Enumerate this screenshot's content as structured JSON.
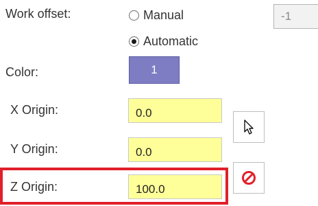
{
  "work_offset": {
    "label": "Work offset:",
    "manual_label": "Manual",
    "automatic_label": "Automatic",
    "selected": "Automatic",
    "offset_value": "-1"
  },
  "color": {
    "label": "Color:",
    "value": "1",
    "swatch_color": "#7e7dc4"
  },
  "x_origin": {
    "label": "X Origin:",
    "value": "0.0"
  },
  "y_origin": {
    "label": "Y Origin:",
    "value": "0.0"
  },
  "z_origin": {
    "label": "Z Origin:",
    "value": "100.0"
  },
  "buttons": {
    "pick_icon": "cursor-arrow-icon",
    "clear_icon": "prohibited-icon"
  },
  "highlight_color": "#e0202a",
  "input_background": "#ffff99"
}
